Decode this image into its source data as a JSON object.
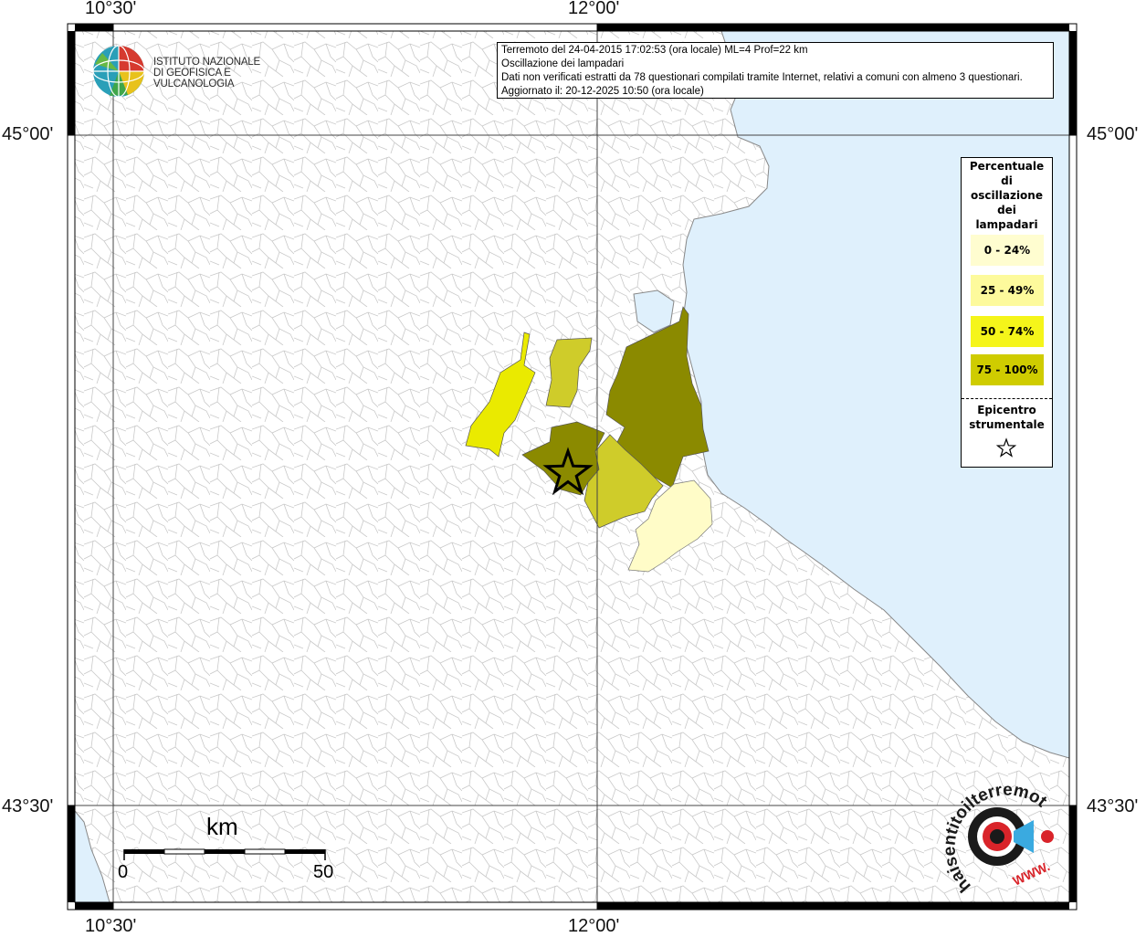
{
  "header": {
    "line1": "Terremoto del 24-04-2015 17:02:53 (ora locale) ML=4 Prof=22 km",
    "line2": "Oscillazione dei lampadari",
    "line3": "Dati non verificati estratti da 78 questionari compilati tramite Internet, relativi a comuni con almeno 3 questionari.",
    "line4": "Aggiornato il: 20-12-2025 10:50 (ora locale)"
  },
  "logo": {
    "line1": "ISTITUTO NAZIONALE",
    "line2": "DI GEOFISICA E VULCANOLOGIA"
  },
  "coordinates": {
    "lon_left": "10°30'",
    "lon_right": "12°00'",
    "lat_top": "45°00'",
    "lat_bottom": "43°30'"
  },
  "legend": {
    "title_lines": [
      "Percentuale",
      "di",
      "oscillazione",
      "dei",
      "lampadari"
    ],
    "items": [
      {
        "label": "0 - 24%",
        "color": "#fffdd0"
      },
      {
        "label": "25 - 49%",
        "color": "#fdfa9c"
      },
      {
        "label": "50 - 74%",
        "color": "#f5f51a"
      },
      {
        "label": "75 - 100%",
        "color": "#cfcc00"
      }
    ],
    "epicenter_lines": [
      "Epicentro",
      "strumentale"
    ],
    "star_icon": "star-outline-icon"
  },
  "scale": {
    "unit": "km",
    "min": "0",
    "max": "50"
  },
  "colors": {
    "sea": "#dff0fc",
    "land": "#ffffff",
    "boundary": "#b8b8b8",
    "class_0_24": "#fffcc8",
    "class_25_49": "#cfcc2a",
    "class_50_74": "#eaea00",
    "class_75_100": "#8b8a00"
  },
  "watermark": {
    "text": "haisentitoilterremoto.it",
    "sub": "WWW."
  }
}
